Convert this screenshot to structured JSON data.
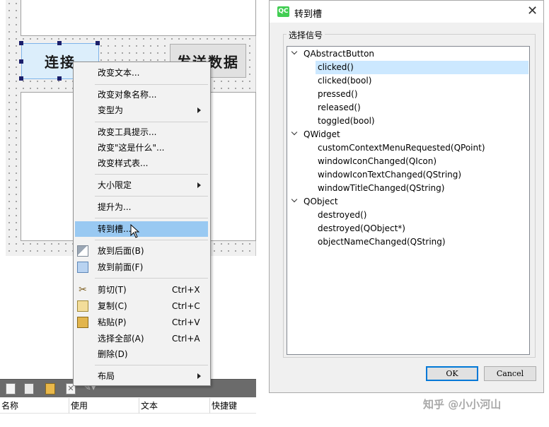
{
  "designer": {
    "connect_button_label": "连接",
    "send_button_label": "发送数据"
  },
  "context_menu": {
    "items": [
      {
        "label": "改变文本...",
        "shortcut": "",
        "submenu": false,
        "icon": ""
      },
      {
        "label": "改变对象名称...",
        "shortcut": "",
        "submenu": false,
        "icon": ""
      },
      {
        "label": "变型为",
        "shortcut": "",
        "submenu": true,
        "icon": ""
      },
      {
        "label": "改变工具提示...",
        "shortcut": "",
        "submenu": false,
        "icon": ""
      },
      {
        "label": "改变\"这是什么\"...",
        "shortcut": "",
        "submenu": false,
        "icon": ""
      },
      {
        "label": "改变样式表...",
        "shortcut": "",
        "submenu": false,
        "icon": ""
      },
      {
        "label": "大小限定",
        "shortcut": "",
        "submenu": true,
        "icon": ""
      },
      {
        "label": "提升为...",
        "shortcut": "",
        "submenu": false,
        "icon": ""
      },
      {
        "label": "转到槽...",
        "shortcut": "",
        "submenu": false,
        "icon": "",
        "highlighted": true
      },
      {
        "label": "放到后面(B)",
        "shortcut": "",
        "submenu": false,
        "icon": "send-to-back-icon"
      },
      {
        "label": "放到前面(F)",
        "shortcut": "",
        "submenu": false,
        "icon": "bring-to-front-icon"
      },
      {
        "label": "剪切(T)",
        "shortcut": "Ctrl+X",
        "submenu": false,
        "icon": "scissors-icon"
      },
      {
        "label": "复制(C)",
        "shortcut": "Ctrl+C",
        "submenu": false,
        "icon": "copy-icon"
      },
      {
        "label": "粘贴(P)",
        "shortcut": "Ctrl+V",
        "submenu": false,
        "icon": "paste-icon"
      },
      {
        "label": "选择全部(A)",
        "shortcut": "Ctrl+A",
        "submenu": false,
        "icon": ""
      },
      {
        "label": "删除(D)",
        "shortcut": "",
        "submenu": false,
        "icon": ""
      },
      {
        "label": "布局",
        "shortcut": "",
        "submenu": true,
        "icon": ""
      }
    ]
  },
  "bottom_panel": {
    "columns": [
      "名称",
      "使用",
      "文本",
      "快捷键"
    ],
    "toolbar_icons": [
      "new-icon",
      "open-icon",
      "paste-icon",
      "delete-icon",
      "edit-icon"
    ]
  },
  "dialog": {
    "title": "转到槽",
    "logo_text": "QC",
    "group_title": "选择信号",
    "tree": [
      {
        "label": "QAbstractButton",
        "level": 0,
        "expanded": true
      },
      {
        "label": "clicked()",
        "level": 1,
        "selected": true
      },
      {
        "label": "clicked(bool)",
        "level": 1
      },
      {
        "label": "pressed()",
        "level": 1
      },
      {
        "label": "released()",
        "level": 1
      },
      {
        "label": "toggled(bool)",
        "level": 1
      },
      {
        "label": "QWidget",
        "level": 0,
        "expanded": true
      },
      {
        "label": "customContextMenuRequested(QPoint)",
        "level": 1
      },
      {
        "label": "windowIconChanged(QIcon)",
        "level": 1
      },
      {
        "label": "windowIconTextChanged(QString)",
        "level": 1
      },
      {
        "label": "windowTitleChanged(QString)",
        "level": 1
      },
      {
        "label": "QObject",
        "level": 0,
        "expanded": true
      },
      {
        "label": "destroyed()",
        "level": 1
      },
      {
        "label": "destroyed(QObject*)",
        "level": 1
      },
      {
        "label": "objectNameChanged(QString)",
        "level": 1
      }
    ],
    "ok_label": "OK",
    "cancel_label": "Cancel"
  },
  "watermark": "知乎 @小小河山"
}
